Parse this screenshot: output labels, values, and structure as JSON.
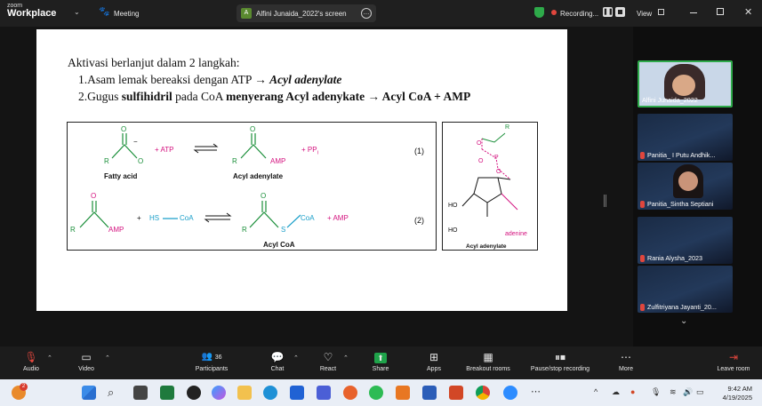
{
  "app": {
    "logo_small": "zoom",
    "logo_big": "Workplace"
  },
  "topbar": {
    "meeting_label": "Meeting",
    "share_avatar_letter": "A",
    "share_label": "Alfini Junaida_2022's screen",
    "recording_label": "Recording...",
    "view_label": "View"
  },
  "slide": {
    "line1": "Aktivasi berlanjut dalam 2 langkah:",
    "line2_prefix": "1.Asam lemak bereaksi dengan ATP → ",
    "line2_emph": "Acyl adenylate",
    "line3_prefix": "2.Gugus ",
    "line3_b1": "sulfihidril",
    "line3_mid": " pada CoA ",
    "line3_b2": "menyerang Acyl adenykate → Acyl CoA + AMP",
    "chem": {
      "o_top1": "O",
      "minus": "−",
      "r1": "R",
      "o_side1": "O",
      "plus_atp": "+ ATP",
      "o_top2": "O",
      "r2": "R",
      "amp1": "AMP",
      "plus_ppi": "+ PP",
      "ppi_sub": "i",
      "eq1": "(1)",
      "fatty_acid": "Fatty acid",
      "acyl_adenylate": "Acyl adenylate",
      "o_top3": "O",
      "r3": "R",
      "amp2": "AMP",
      "plus_hs": "+",
      "hs": "HS",
      "coa1": "CoA",
      "o_top4": "O",
      "r4": "R",
      "s": "S",
      "coa2": "CoA",
      "plus_amp": "+ AMP",
      "eq2": "(2)",
      "acyl_coa": "Acyl CoA",
      "r5": "R",
      "o5": "O",
      "o6": "O",
      "p": "P",
      "o7": "O",
      "ho1": "HO",
      "ho2": "HO",
      "adenine": "adenine",
      "acyl_adenylate2": "Acyl adenylate"
    }
  },
  "participants": [
    {
      "name": "Alfini Junaida_2022"
    },
    {
      "name": "Panitia_ I Putu Andhik..."
    },
    {
      "name": "Panitia_Sintha Septiani"
    },
    {
      "name": "Rania Alysha_2023"
    },
    {
      "name": "Zulfitriyana Jayanti_20..."
    }
  ],
  "toolbar": {
    "audio": "Audio",
    "video": "Video",
    "participants": "Participants",
    "participants_count": "36",
    "chat": "Chat",
    "react": "React",
    "share": "Share",
    "apps": "Apps",
    "breakout": "Breakout rooms",
    "pause_rec": "Pause/stop recording",
    "more": "More",
    "leave": "Leave room"
  },
  "taskbar": {
    "time": "9:42 AM",
    "date": "4/19/2025",
    "badge_count": "2"
  },
  "colors": {
    "chem_green": "#1b8f3a",
    "chem_magenta": "#d4127f",
    "chem_cyan": "#1a9fc9",
    "share_green": "#1fa34a",
    "record_red": "#e0463d"
  }
}
